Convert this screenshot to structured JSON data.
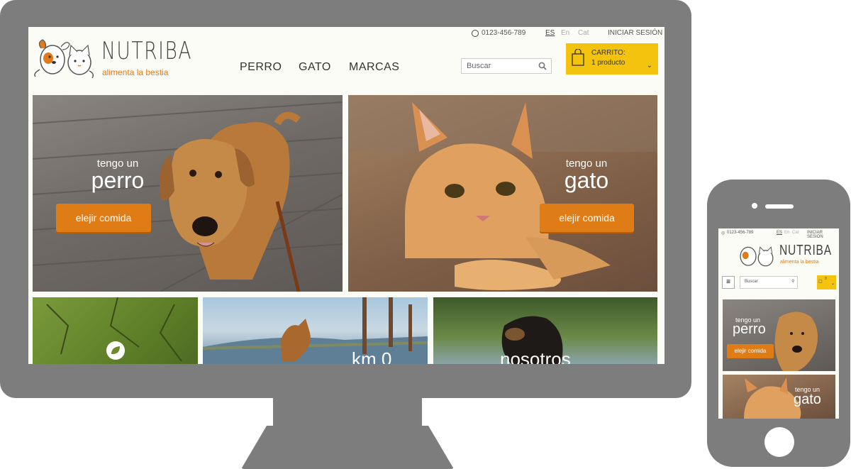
{
  "site": {
    "phone": "0123-456-789",
    "languages": [
      "ES",
      "En",
      "Cat"
    ],
    "active_language": "ES",
    "login": "INICIAR SESIÓN",
    "brand_name": "NUTRIBA",
    "brand_tagline": "alimenta la bestia",
    "nav": [
      "PERRO",
      "GATO",
      "MARCAS"
    ],
    "search_placeholder": "Buscar",
    "cart_title": "CARRITO:",
    "cart_count": "1 producto",
    "mobile_cart_count": "0",
    "brand_color": "#e07a1c",
    "cart_color": "#f3c30e"
  },
  "heroes": [
    {
      "small": "tengo un",
      "large": "perro",
      "button": "elejir comida"
    },
    {
      "small": "tengo un",
      "large": "gato",
      "button": "elejir comida"
    }
  ],
  "tiles": [
    {
      "title": "",
      "icon": "leaf-icon"
    },
    {
      "title": "km 0"
    },
    {
      "title": "nosotros"
    }
  ],
  "device": {
    "frame_color": "#7d7d7d"
  }
}
